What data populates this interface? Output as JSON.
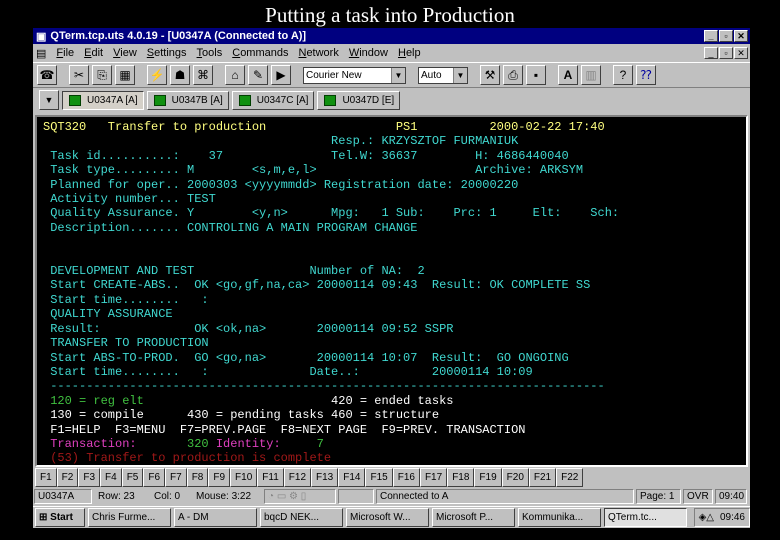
{
  "caption": "Putting a task into Production",
  "window": {
    "title": "QTerm.tcp.uts 4.0.19 - [U0347A (Connected to A)]"
  },
  "menu": [
    "File",
    "Edit",
    "View",
    "Settings",
    "Tools",
    "Commands",
    "Network",
    "Window",
    "Help"
  ],
  "toolbar": {
    "font": "Courier New",
    "size": "Auto"
  },
  "sessions": [
    {
      "label": "U0347A [A]",
      "active": true
    },
    {
      "label": "U0347B [A]"
    },
    {
      "label": "U0347C [A]"
    },
    {
      "label": "U0347D [E]"
    }
  ],
  "colors": {
    "y": "#ffff80",
    "c": "#40d8d0",
    "g": "#40c040",
    "w": "#ffffff",
    "m": "#e040c0",
    "r": "#a01818"
  },
  "terminal": {
    "lines": [
      [
        [
          "SQT320   Transfer to production                  PS1          2000-02-22 17:40",
          "y"
        ]
      ],
      [
        [
          "                                        Resp.: KRZYSZTOF FURMANIUK",
          "c"
        ]
      ],
      [
        [
          " Task id..........:    37               Tel.W: 36637        H: 4686440040",
          "c"
        ]
      ],
      [
        [
          " Task type......... M        <s,m,e,l>                      Archive: ARKSYM",
          "c"
        ]
      ],
      [
        [
          " Planned for oper.. 2000303 <yyyymmdd> Registration date: 20000220",
          "c"
        ]
      ],
      [
        [
          " Activity number... TEST",
          "c"
        ]
      ],
      [
        [
          " Quality Assurance. Y        <y,n>      Mpg:   1 Sub:    Prc: 1     Elt:    Sch:",
          "c"
        ]
      ],
      [
        [
          " Description....... CONTROLING A MAIN PROGRAM CHANGE",
          "c"
        ]
      ],
      [
        [
          "",
          "c"
        ]
      ],
      [
        [
          "",
          "c"
        ]
      ],
      [
        [
          " DEVELOPMENT AND TEST                Number of NA:  2",
          "c"
        ]
      ],
      [
        [
          " Start CREATE-ABS..  OK <go,gf,na,ca> 20000114 09:43  Result: OK COMPLETE SS",
          "c"
        ]
      ],
      [
        [
          " Start time........   :",
          "c"
        ]
      ],
      [
        [
          " QUALITY ASSURANCE",
          "c"
        ]
      ],
      [
        [
          " Result:             OK <ok,na>       20000114 09:52 SSPR",
          "c"
        ]
      ],
      [
        [
          " TRANSFER TO PRODUCTION",
          "c"
        ]
      ],
      [
        [
          " Start ABS-TO-PROD.  GO <go,na>       20000114 10:07  Result:  GO ONGOING",
          "c"
        ]
      ],
      [
        [
          " Start time........   :              Date..:          20000114 10:09",
          "c"
        ]
      ],
      [
        [
          " -----------------------------------------------------------------------------",
          "c"
        ]
      ],
      [
        [
          " 120 = reg elt",
          "g"
        ],
        [
          "                          420 = ended tasks",
          "w"
        ]
      ],
      [
        [
          " 130 = compile      430 = pending tasks 460 = structure",
          "w"
        ]
      ],
      [
        [
          " F1=HELP  F3=MENU  F7=PREV.PAGE  F8=NEXT PAGE  F9=PREV. TRANSACTION",
          "w"
        ]
      ],
      [
        [
          " Transaction:",
          "m"
        ],
        [
          "       320",
          "g"
        ],
        [
          " Identity:",
          "m"
        ],
        [
          "     7",
          "g"
        ]
      ],
      [
        [
          " (53) Transfer to production is complete",
          "r"
        ]
      ]
    ]
  },
  "fkeys": [
    "F1",
    "F2",
    "F3",
    "F4",
    "F5",
    "F6",
    "F7",
    "F8",
    "F9",
    "F10",
    "F11",
    "F12",
    "F13",
    "F14",
    "F15",
    "F16",
    "F17",
    "F18",
    "F19",
    "F20",
    "F21",
    "F22"
  ],
  "status": {
    "session": "U0347A",
    "row": "Row: 23",
    "col": "Col: 0",
    "mouse": "Mouse:  3:22",
    "connection": "Connected to A",
    "page": "Page: 1",
    "mode": "OVR",
    "time": "09:40"
  },
  "taskbar": {
    "start": "Start",
    "tasks": [
      "Chris Furme...",
      "A - DM",
      "bqcD NEK...",
      "Microsoft W...",
      "Microsoft P...",
      "Kommunika...",
      "QTerm.tc..."
    ],
    "clock": "09:46"
  }
}
